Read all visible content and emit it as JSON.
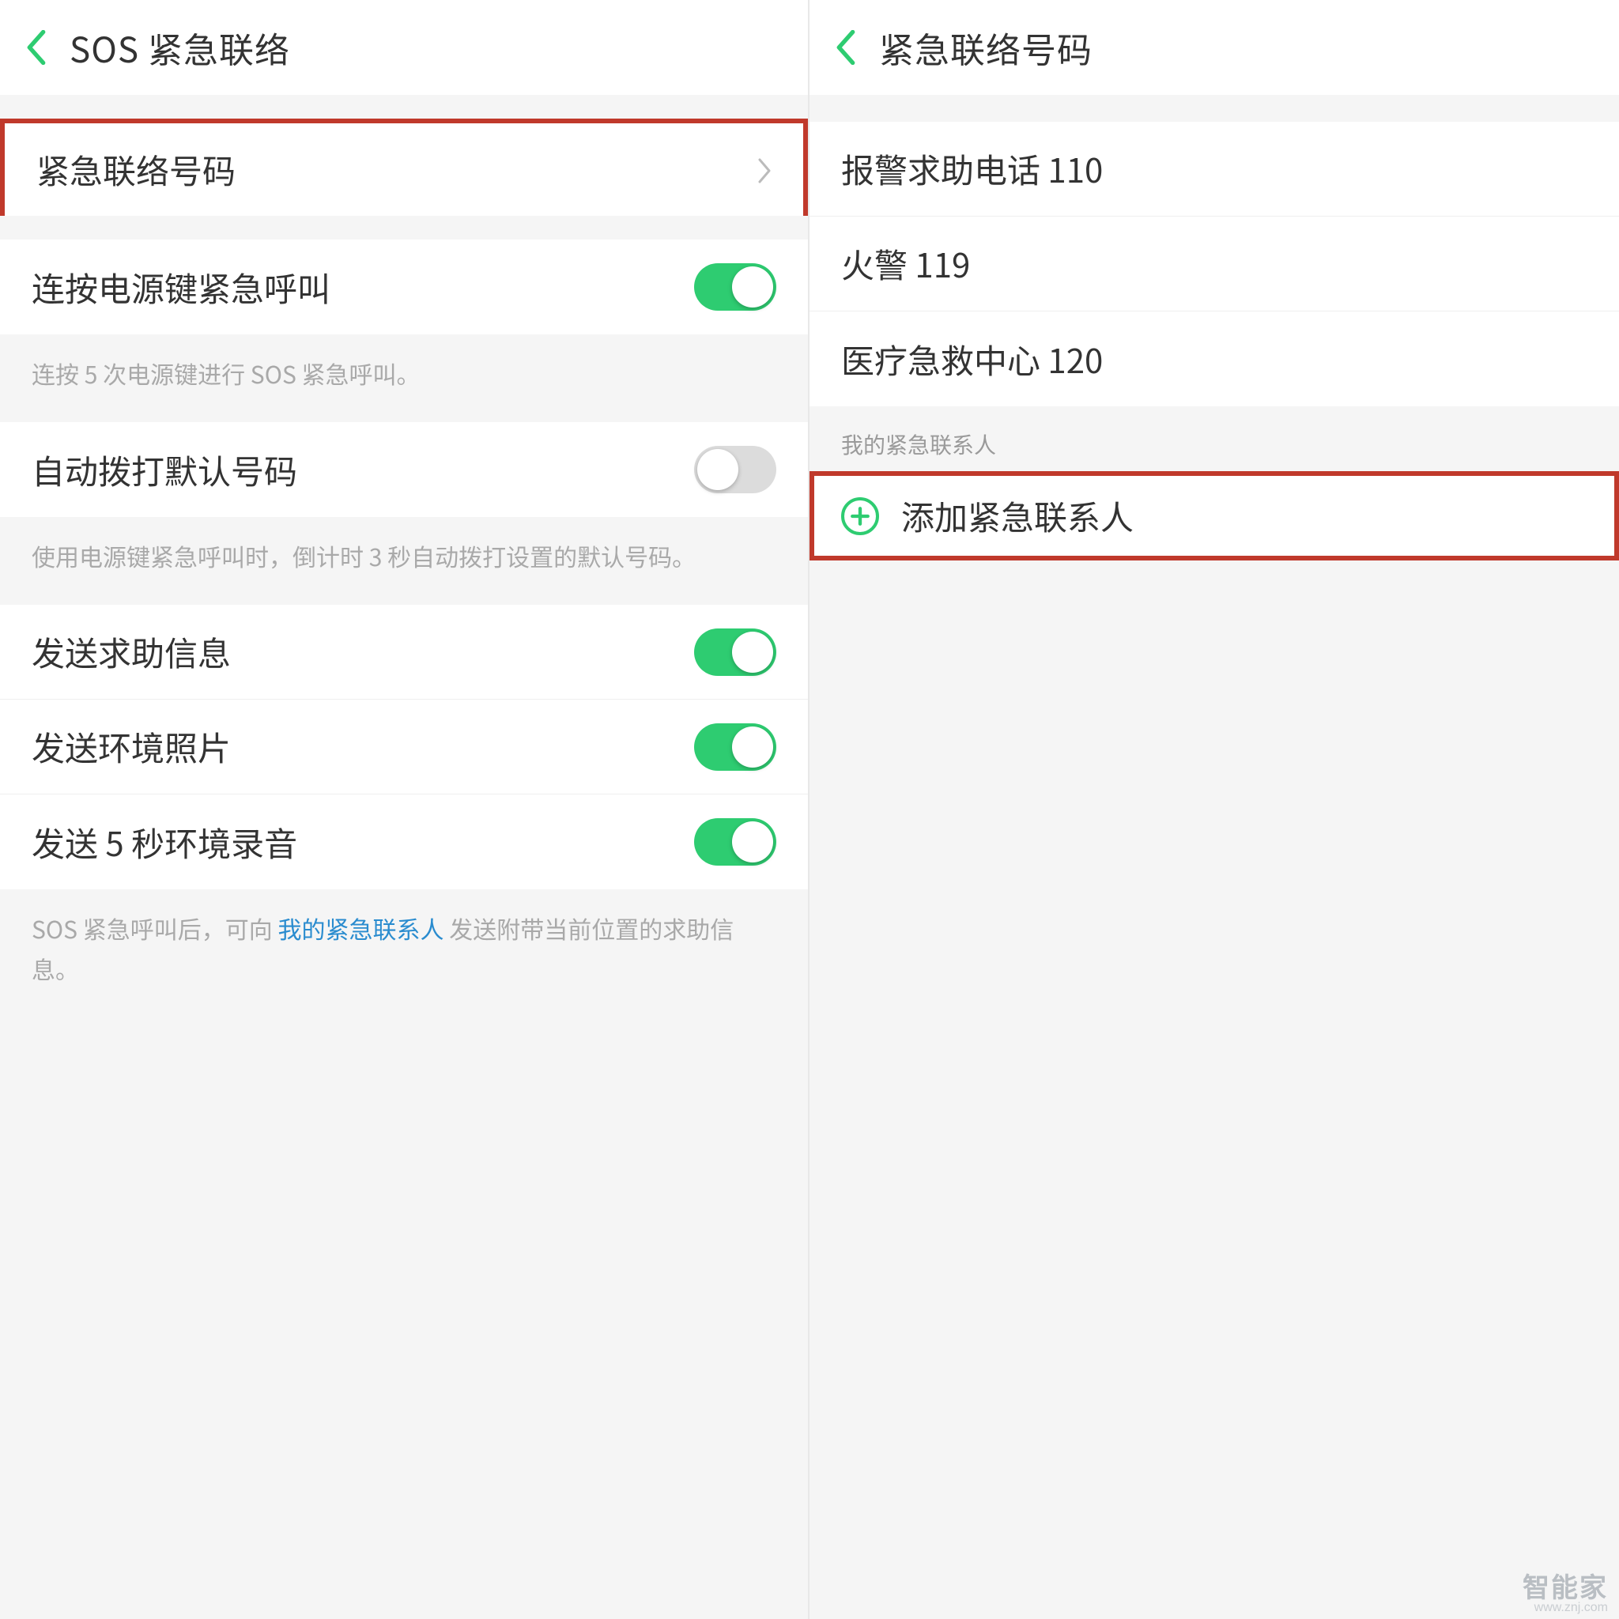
{
  "left": {
    "header_title": "SOS 紧急联络",
    "rows": {
      "emergency_numbers": "紧急联络号码",
      "power_button_call": "连按电源键紧急呼叫",
      "power_button_desc": "连按 5 次电源键进行 SOS 紧急呼叫。",
      "auto_dial": "自动拨打默认号码",
      "auto_dial_desc": "使用电源键紧急呼叫时，倒计时 3 秒自动拨打设置的默认号码。",
      "send_help": "发送求助信息",
      "send_photo": "发送环境照片",
      "send_audio": "发送 5 秒环境录音",
      "footer_desc_pre": "SOS 紧急呼叫后，可向 ",
      "footer_desc_link": "我的紧急联系人",
      "footer_desc_post": " 发送附带当前位置的求助信息。"
    },
    "toggles": {
      "power_button_call": "on",
      "auto_dial": "off",
      "send_help": "on",
      "send_photo": "on",
      "send_audio": "on"
    }
  },
  "right": {
    "header_title": "紧急联络号码",
    "numbers": {
      "police": "报警求助电话 110",
      "fire": "火警 119",
      "medical": "医疗急救中心 120"
    },
    "section_label": "我的紧急联系人",
    "add_contact": "添加紧急联系人"
  },
  "watermark": {
    "main": "智能家",
    "sub": "www.znj.com"
  },
  "colors": {
    "accent": "#2ecc71",
    "highlight_border": "#c0392b",
    "link": "#2a8ccf"
  }
}
